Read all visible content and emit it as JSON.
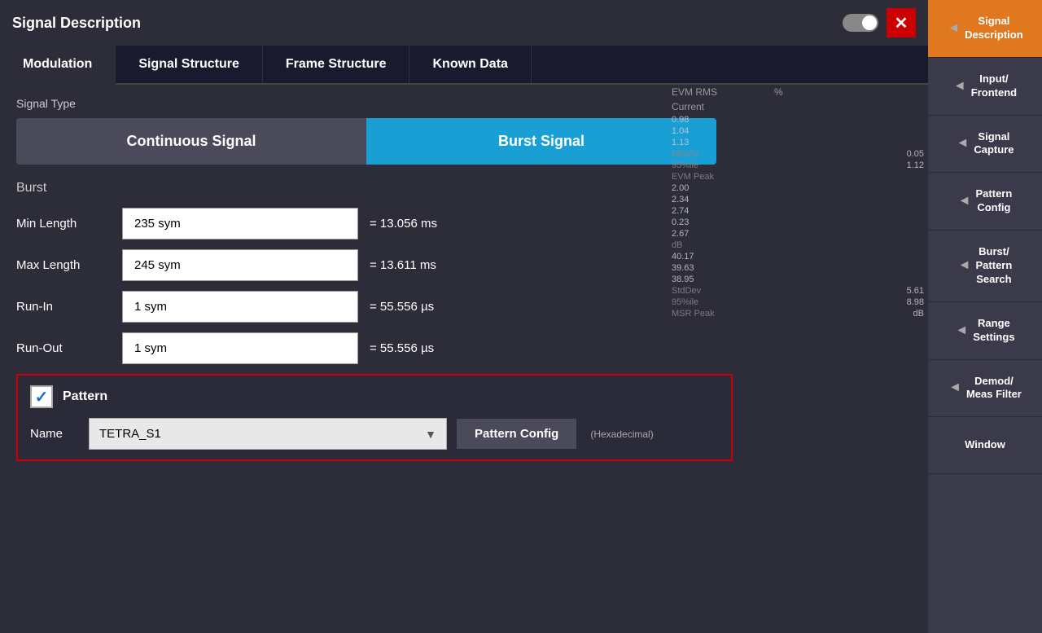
{
  "dialog": {
    "title": "Signal Description",
    "close_label": "✕"
  },
  "tabs": [
    {
      "id": "modulation",
      "label": "Modulation",
      "active": true
    },
    {
      "id": "signal-structure",
      "label": "Signal Structure",
      "active": false
    },
    {
      "id": "frame-structure",
      "label": "Frame Structure",
      "active": false
    },
    {
      "id": "known-data",
      "label": "Known Data",
      "active": false
    }
  ],
  "signal_type": {
    "label": "Signal Type",
    "options": [
      {
        "label": "Continuous Signal",
        "active": false
      },
      {
        "label": "Burst Signal",
        "active": true
      }
    ]
  },
  "burst_label": "Burst",
  "fields": [
    {
      "label": "Min Length",
      "value": "235 sym",
      "unit": "= 13.056 ms"
    },
    {
      "label": "Max Length",
      "value": "245 sym",
      "unit": "= 13.611 ms"
    },
    {
      "label": "Run-In",
      "value": "1 sym",
      "unit": "= 55.556 µs"
    },
    {
      "label": "Run-Out",
      "value": "1 sym",
      "unit": "= 55.556 µs"
    }
  ],
  "pattern": {
    "checked": true,
    "label": "Pattern",
    "name_label": "Name",
    "name_value": "TETRA_S1",
    "config_btn": "Pattern Config",
    "hex_label": "(Hexadecimal)"
  },
  "bg_data": {
    "header1": "EVM RMS",
    "header2": "%",
    "header3": "Current",
    "rows": [
      {
        "label": "",
        "value": "0.98"
      },
      {
        "label": "",
        "value": "1.04"
      },
      {
        "label": "",
        "value": "1.13"
      },
      {
        "label": "Min/Av",
        "value": "0.05"
      },
      {
        "label": "95%ile",
        "value": "1.12"
      },
      {
        "label": "EVM Peak",
        "value": ""
      },
      {
        "label": "",
        "value": "2.00"
      },
      {
        "label": "",
        "value": "2.34"
      },
      {
        "label": "",
        "value": "2.74"
      },
      {
        "label": "",
        "value": "0.23"
      },
      {
        "label": "",
        "value": "2.67"
      },
      {
        "label": "dB",
        "value": ""
      },
      {
        "label": "",
        "value": "40.17"
      },
      {
        "label": "",
        "value": "39.63"
      },
      {
        "label": "",
        "value": "38.95"
      },
      {
        "label": "StdDev",
        "value": "5.61"
      },
      {
        "label": "95%ile",
        "value": "8.98"
      },
      {
        "label": "MSR Peak",
        "value": "dB"
      }
    ]
  },
  "sidebar": {
    "items": [
      {
        "label": "Signal\nDescription",
        "active": true,
        "arrow": "◄"
      },
      {
        "label": "Input/\nFrontend",
        "active": false,
        "arrow": "◄"
      },
      {
        "label": "Signal\nCapture",
        "active": false,
        "arrow": "◄"
      },
      {
        "label": "Pattern\nConfig",
        "active": false,
        "arrow": "◄"
      },
      {
        "label": "Burst/\nPattern\nSearch",
        "active": false,
        "arrow": "◄"
      },
      {
        "label": "Range\nSettings",
        "active": false,
        "arrow": "◄"
      },
      {
        "label": "Demod/\nMeas Filter",
        "active": false,
        "arrow": "◄"
      },
      {
        "label": "Window",
        "active": false,
        "arrow": "◄"
      }
    ]
  }
}
